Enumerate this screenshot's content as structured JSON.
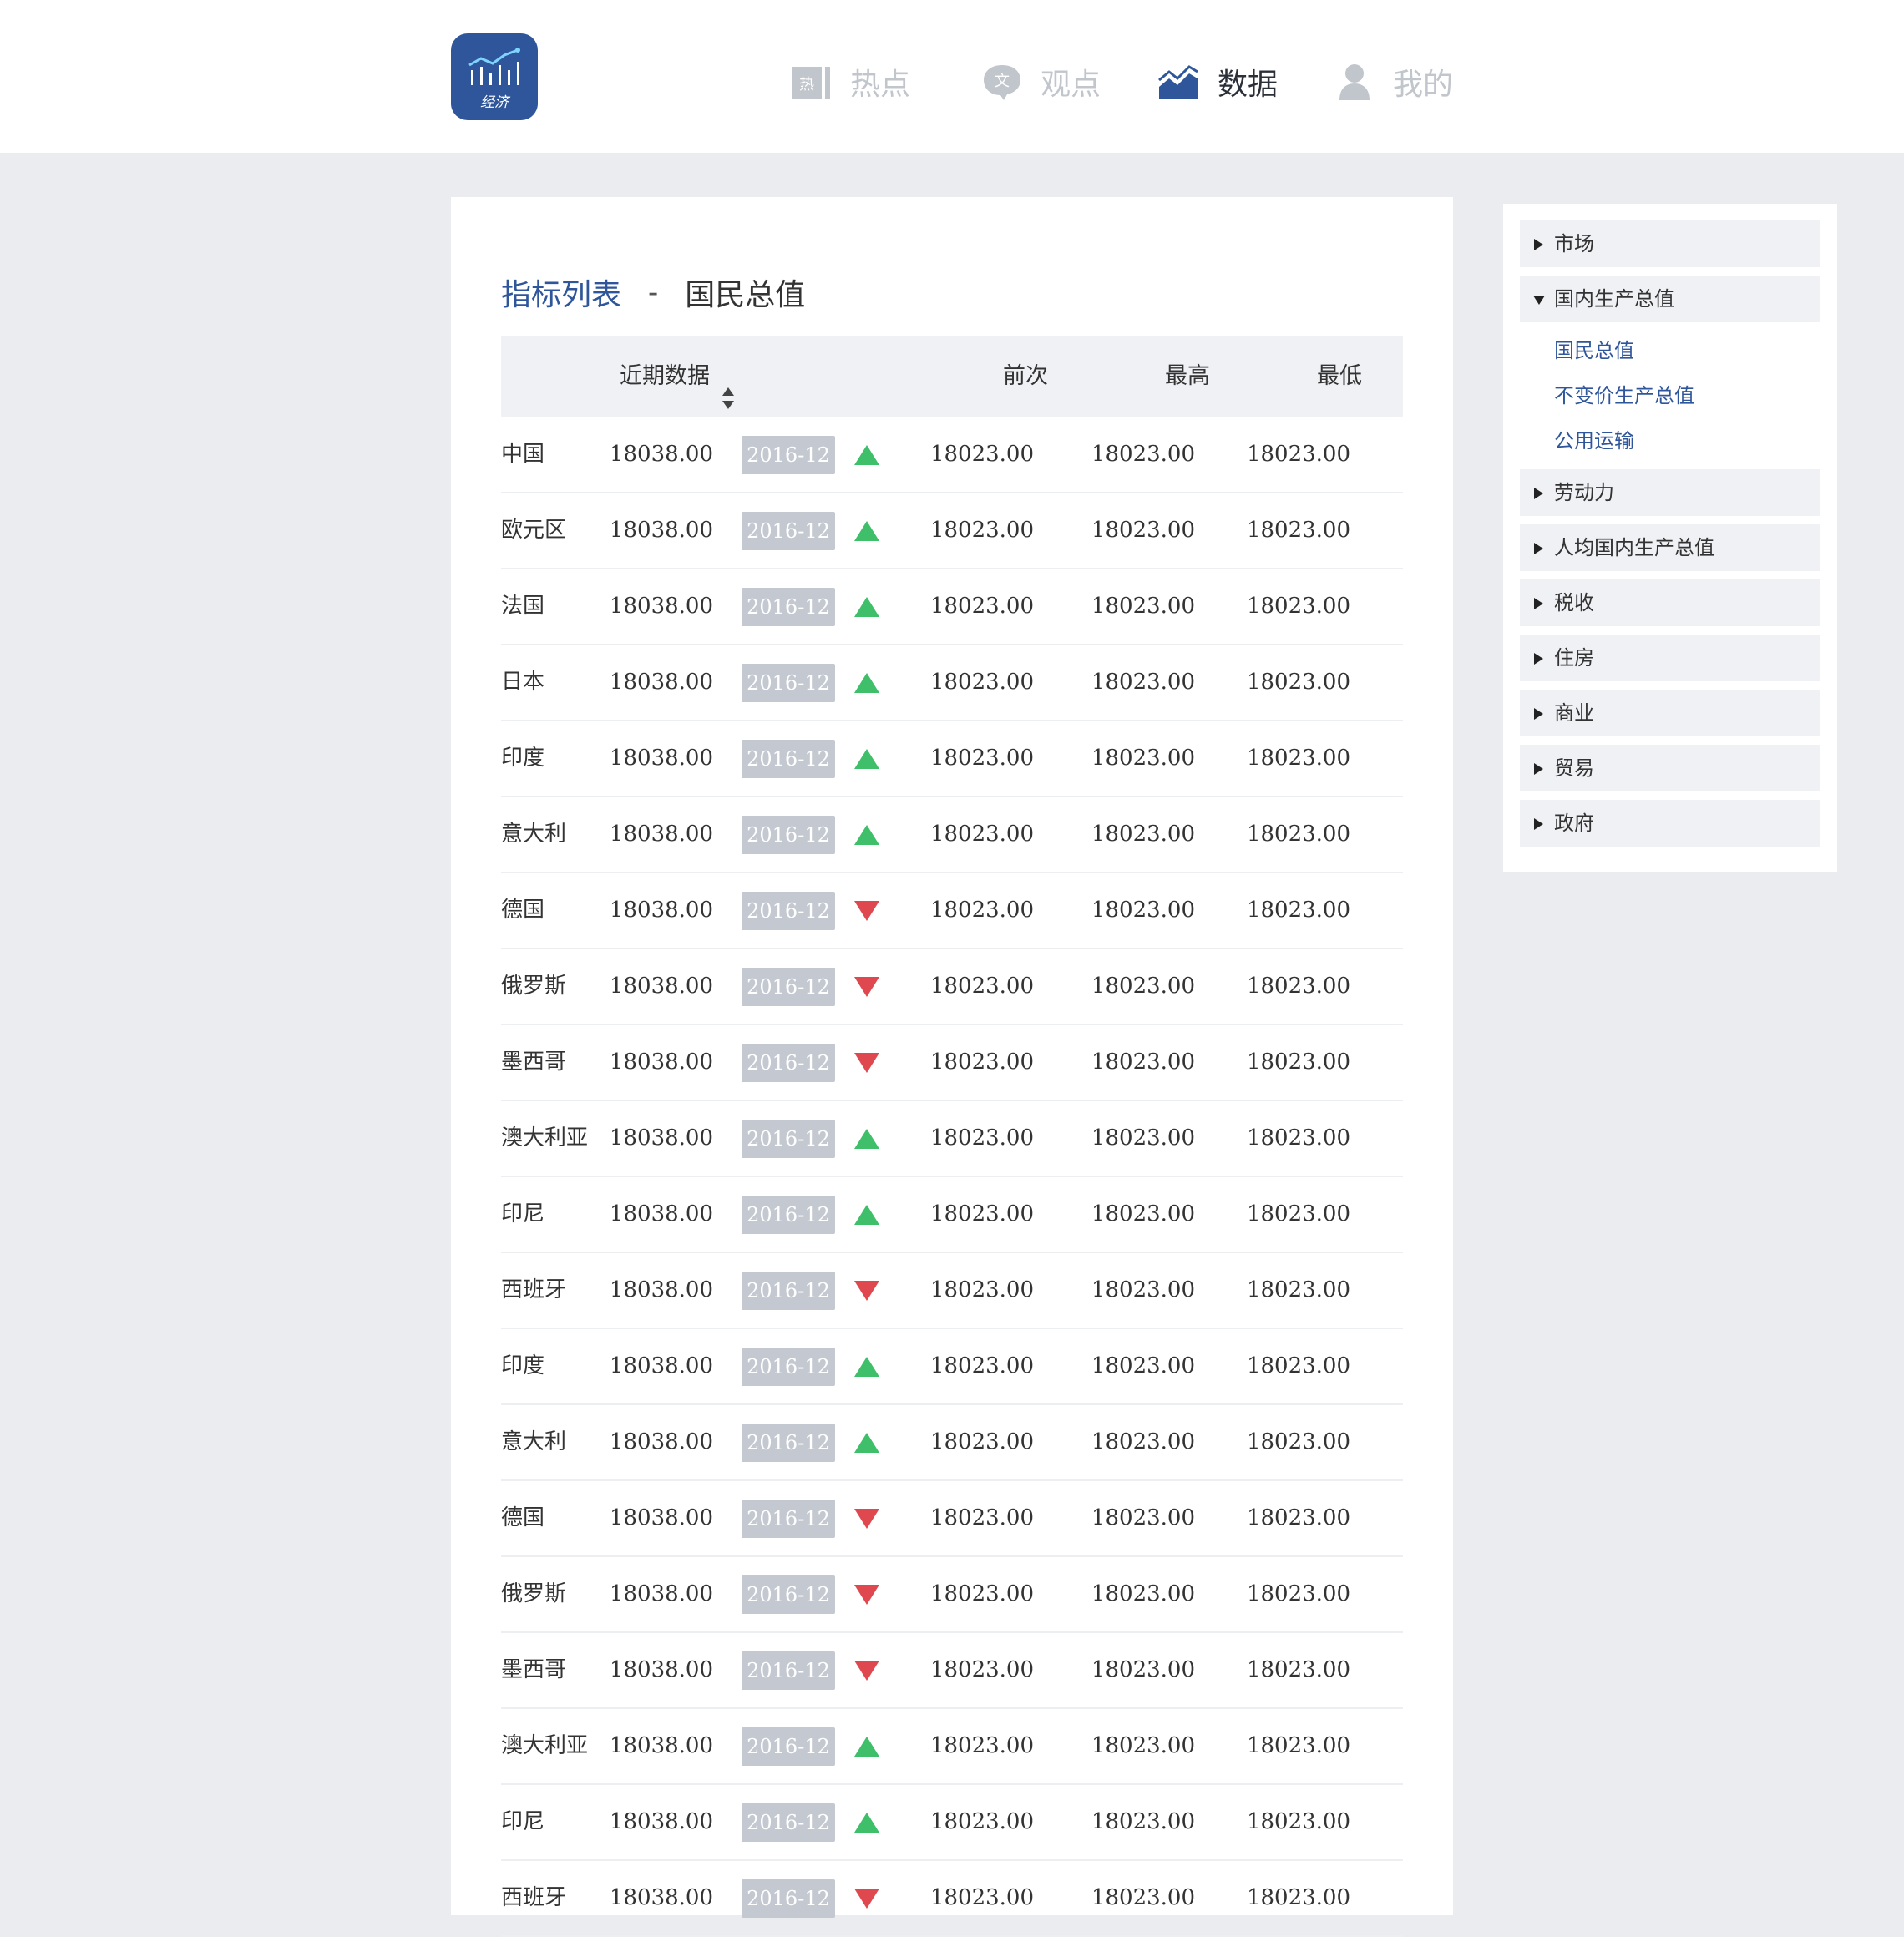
{
  "header": {
    "logo_text": "经济",
    "nav": [
      {
        "label": "热点",
        "icon": "hot-icon",
        "active": false
      },
      {
        "label": "观点",
        "icon": "opinion-icon",
        "active": false
      },
      {
        "label": "数据",
        "icon": "data-chart-icon",
        "active": true
      },
      {
        "label": "我的",
        "icon": "user-icon",
        "active": false
      }
    ],
    "hot_icon_glyph": "热",
    "opinion_icon_glyph": "文"
  },
  "main": {
    "breadcrumb": "指标列表",
    "separator": "-",
    "current": "国民总值",
    "columns": {
      "recent": "近期数据",
      "prev": "前次",
      "high": "最高",
      "low": "最低"
    },
    "rows": [
      {
        "country": "中国",
        "recent": "18038.00",
        "date": "2016-12",
        "trend": "up",
        "prev": "18023.00",
        "high": "18023.00",
        "low": "18023.00"
      },
      {
        "country": "欧元区",
        "recent": "18038.00",
        "date": "2016-12",
        "trend": "up",
        "prev": "18023.00",
        "high": "18023.00",
        "low": "18023.00"
      },
      {
        "country": "法国",
        "recent": "18038.00",
        "date": "2016-12",
        "trend": "up",
        "prev": "18023.00",
        "high": "18023.00",
        "low": "18023.00"
      },
      {
        "country": "日本",
        "recent": "18038.00",
        "date": "2016-12",
        "trend": "up",
        "prev": "18023.00",
        "high": "18023.00",
        "low": "18023.00"
      },
      {
        "country": "印度",
        "recent": "18038.00",
        "date": "2016-12",
        "trend": "up",
        "prev": "18023.00",
        "high": "18023.00",
        "low": "18023.00"
      },
      {
        "country": "意大利",
        "recent": "18038.00",
        "date": "2016-12",
        "trend": "up",
        "prev": "18023.00",
        "high": "18023.00",
        "low": "18023.00"
      },
      {
        "country": "德国",
        "recent": "18038.00",
        "date": "2016-12",
        "trend": "down",
        "prev": "18023.00",
        "high": "18023.00",
        "low": "18023.00"
      },
      {
        "country": "俄罗斯",
        "recent": "18038.00",
        "date": "2016-12",
        "trend": "down",
        "prev": "18023.00",
        "high": "18023.00",
        "low": "18023.00"
      },
      {
        "country": "墨西哥",
        "recent": "18038.00",
        "date": "2016-12",
        "trend": "down",
        "prev": "18023.00",
        "high": "18023.00",
        "low": "18023.00"
      },
      {
        "country": "澳大利亚",
        "recent": "18038.00",
        "date": "2016-12",
        "trend": "up",
        "prev": "18023.00",
        "high": "18023.00",
        "low": "18023.00"
      },
      {
        "country": "印尼",
        "recent": "18038.00",
        "date": "2016-12",
        "trend": "up",
        "prev": "18023.00",
        "high": "18023.00",
        "low": "18023.00"
      },
      {
        "country": "西班牙",
        "recent": "18038.00",
        "date": "2016-12",
        "trend": "down",
        "prev": "18023.00",
        "high": "18023.00",
        "low": "18023.00"
      },
      {
        "country": "印度",
        "recent": "18038.00",
        "date": "2016-12",
        "trend": "up",
        "prev": "18023.00",
        "high": "18023.00",
        "low": "18023.00"
      },
      {
        "country": "意大利",
        "recent": "18038.00",
        "date": "2016-12",
        "trend": "up",
        "prev": "18023.00",
        "high": "18023.00",
        "low": "18023.00"
      },
      {
        "country": "德国",
        "recent": "18038.00",
        "date": "2016-12",
        "trend": "down",
        "prev": "18023.00",
        "high": "18023.00",
        "low": "18023.00"
      },
      {
        "country": "俄罗斯",
        "recent": "18038.00",
        "date": "2016-12",
        "trend": "down",
        "prev": "18023.00",
        "high": "18023.00",
        "low": "18023.00"
      },
      {
        "country": "墨西哥",
        "recent": "18038.00",
        "date": "2016-12",
        "trend": "down",
        "prev": "18023.00",
        "high": "18023.00",
        "low": "18023.00"
      },
      {
        "country": "澳大利亚",
        "recent": "18038.00",
        "date": "2016-12",
        "trend": "up",
        "prev": "18023.00",
        "high": "18023.00",
        "low": "18023.00"
      },
      {
        "country": "印尼",
        "recent": "18038.00",
        "date": "2016-12",
        "trend": "up",
        "prev": "18023.00",
        "high": "18023.00",
        "low": "18023.00"
      },
      {
        "country": "西班牙",
        "recent": "18038.00",
        "date": "2016-12",
        "trend": "down",
        "prev": "18023.00",
        "high": "18023.00",
        "low": "18023.00"
      }
    ]
  },
  "sidebar": {
    "items": [
      {
        "label": "市场",
        "expanded": false
      },
      {
        "label": "国内生产总值",
        "expanded": true,
        "children": [
          "国民总值",
          "不变价生产总值",
          "公用运输"
        ]
      },
      {
        "label": "劳动力",
        "expanded": false
      },
      {
        "label": "人均国内生产总值",
        "expanded": false
      },
      {
        "label": "税收",
        "expanded": false
      },
      {
        "label": "住房",
        "expanded": false
      },
      {
        "label": "商业",
        "expanded": false
      },
      {
        "label": "贸易",
        "expanded": false
      },
      {
        "label": "政府",
        "expanded": false
      }
    ]
  },
  "colors": {
    "accent": "#2f569b",
    "up": "#3fbf6a",
    "down": "#e0484f",
    "badge": "#c4c9d1",
    "background": "#eaecf0"
  }
}
